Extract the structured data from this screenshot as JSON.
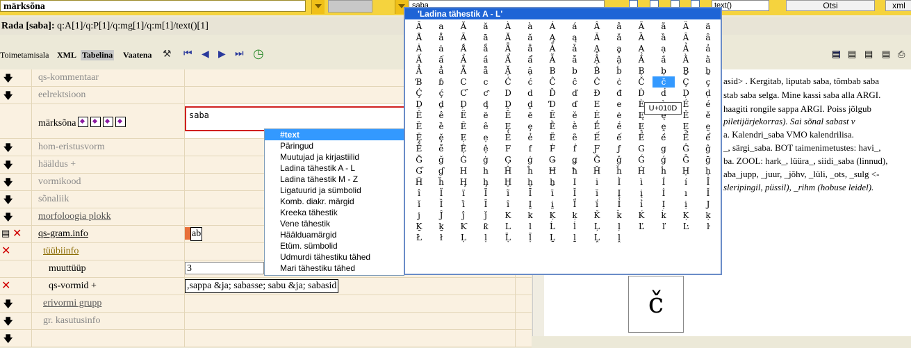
{
  "topbar": {
    "headword_value": "märksõna",
    "search_value": "saba",
    "xpath_select": "text()",
    "search_button": "Otsi",
    "xml_button": "xml"
  },
  "path": {
    "label": "Rada [saba]:",
    "value": "q:A[1]/q:P[1]/q:mg[1]/q:m[1]/text()[1]"
  },
  "toolbar": {
    "edit_area": "Toimetamisala",
    "xml": "XML",
    "table": "Tabelina",
    "view": "Vaatena"
  },
  "rows": [
    {
      "label": "qs-kommentaar"
    },
    {
      "label": "eelrektsioon"
    },
    {
      "label": "märksõna",
      "value": "saba"
    },
    {
      "label": "hom-eristusvorm"
    },
    {
      "label": "hääldus +"
    },
    {
      "label": "vormikood"
    },
    {
      "label": "sõnaliik"
    },
    {
      "label": "morfoloogia plokk"
    },
    {
      "label": "qs-gram.info",
      "value": "ab"
    },
    {
      "label": "tüübiinfo"
    },
    {
      "label": "muuttüüp",
      "value": "3"
    },
    {
      "label": "qs-vormid +",
      "value": ",sappa &ja; sabasse; sabu &ja; sabasid"
    },
    {
      "label": "erivormi grupp"
    },
    {
      "label": "gr. kasutusinfo"
    }
  ],
  "menu": {
    "items": [
      "#text",
      "Päringud",
      "Muutujad ja kirjastiilid",
      "Ladina tähestik A - L",
      "Ladina tähestik M - Z",
      "Ligatuurid ja sümbolid",
      "Komb. diakr. märgid",
      "Kreeka tähestik",
      "Vene tähestik",
      "Häälduamärgid",
      "Etüm. sümbolid",
      "Udmurdi tähestiku tähed",
      "Mari tähestiku tähed"
    ]
  },
  "charpopup": {
    "title": "'Ladina tähestik A - L'",
    "chars": "ĀaĂăÀàÁáÂâÃãÄäÅåĀāĂăĄąǍǎȀȁȂȃȦȧǺǻǞǟǠǡḀḁẠạẢảẤấẦầẨẩẪẫẬậẮắẰằẲẳẴẵẶặBbḂḃḄḅḆḇƁɓCcĆćĈĉĊċČčÇçḈḉƇƈDdĎďĐđḊḋḌḍḎḏḐḑḒḓƊɗEeÈèÉéÊêËëĒēĔĕĖėĘęĚěȄȅȆȇȨȩḔḕḖḗḘḙḚḛḜḝẸẹẺẻẼẽẾếỀềỂểỄễỆệFfḞḟƑƒGgĜĝĞğĠġĢģǤǥǦǧǴǵḠḡƓɠHhĤĥĦħȞȟḢḣḤḥḦḧḨḩḪḫẖIiÌìÍíÎîÏïĨĩĪīĬĭĮįİıǏǐȈȉȊȋḬḭḮḯỈỉỊịJjĴĵǰKkĶķǨǩḰḱḲḳḴḵƘƙLlĹĺĻļĽľĿŀŁłḶḷḸḹḺḻḼḽ",
    "tooltip": "U+010D",
    "preview_char": "č"
  },
  "right_text": {
    "line1": "asid> . Kergitab, liputab saba, tõmbab saba",
    "line2": "stab saba selga. Mine kassi saba alla ARGI.",
    "line3": "haagiti rongile sappa ARGI. Poiss jõlgub",
    "line4": "piletijärjekorras). Sai sõnal sabast v",
    "line5": "a. Kalendri_saba VMO kalendrilisa.",
    "line6": "_, särgi_saba. BOT taimenimetustes: havi_,",
    "line7": "ba. ZOOL: hark_, lüüra_, siidi_saba (linnud),",
    "line8": "aba_jupp, _juur, _jõhv, _lüli, _ots, _sulg <-",
    "line9": "sleripingil, püssil), _rihm (hobuse leidel)."
  },
  "colors": {
    "accent": "#f5d33e",
    "menu_select": "#3399ff",
    "popup_title": "#1e64d6"
  }
}
